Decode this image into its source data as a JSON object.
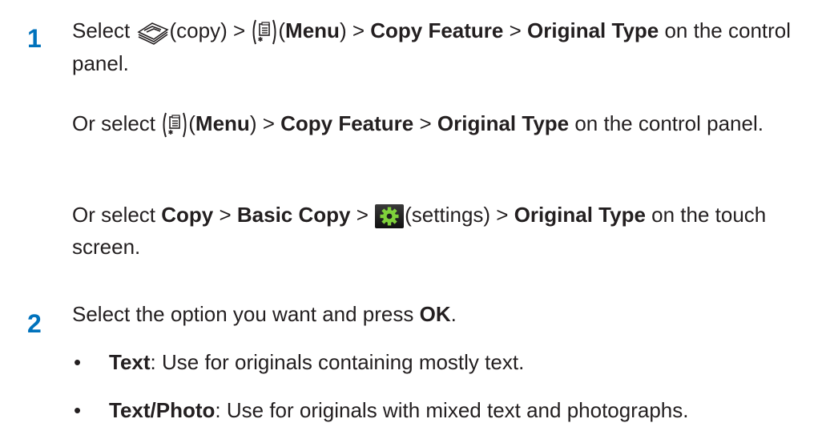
{
  "step1": {
    "number": "1",
    "line1": {
      "select": "Select ",
      "copy_paren": "(copy) > ",
      "menu_open": "(",
      "menu": "Menu",
      "menu_close": ") > ",
      "copy_feature": "Copy Feature",
      "sep": " > ",
      "original_type": "Original Type",
      "tail": " on the control panel."
    },
    "line2": {
      "or_select": "Or select ",
      "menu_open": "(",
      "menu": "Menu",
      "menu_close": ") > ",
      "copy_feature": "Copy Feature",
      "sep": " > ",
      "original_type": "Original Type",
      "tail": " on the control panel."
    },
    "line3": {
      "or_select": "Or select ",
      "copy": "Copy",
      "sep1": " > ",
      "basic_copy": "Basic Copy",
      "sep2": " > ",
      "settings_paren": "(settings) > ",
      "original_type": "Original Type",
      "tail": " on the touch screen."
    }
  },
  "step2": {
    "number": "2",
    "text": "Select the option you want and press ",
    "ok": "OK",
    "period": ".",
    "options": [
      {
        "bullet": "•",
        "name": "Text",
        "desc": ": Use for originals containing mostly text."
      },
      {
        "bullet": "•",
        "name": "Text/Photo",
        "desc": ": Use for originals with mixed text and photographs."
      }
    ]
  },
  "icons": {
    "copy": "copy-icon",
    "menu": "menu-icon",
    "settings": "settings-gear-icon"
  },
  "colors": {
    "step_number": "#0072bc",
    "text": "#231f20"
  }
}
